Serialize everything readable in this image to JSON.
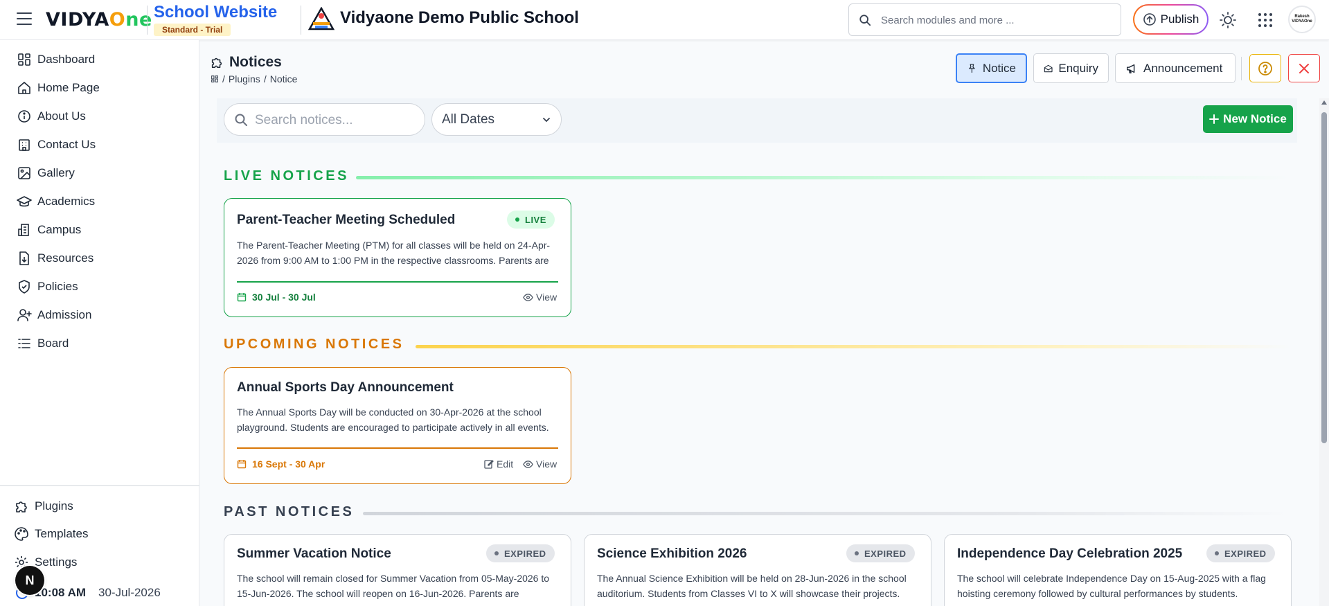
{
  "header": {
    "logo_text": "VIDYAOne",
    "site_title": "School Website",
    "plan_badge": "Standard - Trial",
    "school_name": "Vidyaone Demo Public School",
    "search_placeholder": "Search modules and more ...",
    "publish_label": "Publish",
    "avatar_line1": "Rakesh",
    "avatar_line2": "VIDYAOne"
  },
  "sidebar": {
    "items": [
      {
        "label": "Dashboard",
        "icon": "dashboard-icon"
      },
      {
        "label": "Home Page",
        "icon": "home-icon"
      },
      {
        "label": "About Us",
        "icon": "info-icon"
      },
      {
        "label": "Contact Us",
        "icon": "building-icon"
      },
      {
        "label": "Gallery",
        "icon": "image-icon"
      },
      {
        "label": "Academics",
        "icon": "graduation-cap-icon"
      },
      {
        "label": "Campus",
        "icon": "campus-icon"
      },
      {
        "label": "Resources",
        "icon": "file-download-icon"
      },
      {
        "label": "Policies",
        "icon": "shield-check-icon"
      },
      {
        "label": "Admission",
        "icon": "user-plus-icon"
      },
      {
        "label": "Board",
        "icon": "list-icon"
      }
    ],
    "bottom_items": [
      {
        "label": "Plugins",
        "icon": "puzzle-icon"
      },
      {
        "label": "Templates",
        "icon": "palette-icon"
      },
      {
        "label": "Settings",
        "icon": "gear-icon"
      }
    ],
    "fab_letter": "N",
    "time": "10:08 AM",
    "date": "30-Jul-2026"
  },
  "page": {
    "title": "Notices",
    "breadcrumb": [
      "Plugins",
      "Notice"
    ],
    "tabs": [
      {
        "label": "Notice",
        "icon": "pin-icon",
        "active": true
      },
      {
        "label": "Enquiry",
        "icon": "mail-open-icon",
        "active": false
      },
      {
        "label": "Announcement",
        "icon": "megaphone-icon",
        "active": false
      }
    ]
  },
  "filters": {
    "search_placeholder": "Search notices...",
    "date_filter": "All Dates",
    "new_notice_label": "New Notice"
  },
  "sections": {
    "live": "LIVE NOTICES",
    "upcoming": "UPCOMING NOTICES",
    "past": "PAST NOTICES"
  },
  "live_notices": [
    {
      "title": "Parent-Teacher Meeting Scheduled",
      "status": "LIVE",
      "description": "The Parent-Teacher Meeting (PTM) for all classes will be held on 24-Apr-2026 from 9:00 AM to 1:00 PM in the respective classrooms. Parents are requested to attend.",
      "date_range": "30 Jul - 30 Jul",
      "view_label": "View"
    }
  ],
  "upcoming_notices": [
    {
      "title": "Annual Sports Day Announcement",
      "description": "The Annual Sports Day will be conducted on 30-Apr-2026 at the school playground. Students are encouraged to participate actively in all events.",
      "date_range": "16 Sept - 30 Apr",
      "edit_label": "Edit",
      "view_label": "View"
    }
  ],
  "past_notices": [
    {
      "title": "Summer Vacation Notice",
      "status": "EXPIRED",
      "description": "The school will remain closed for Summer Vacation from 05-May-2026 to 15-Jun-2026. The school will reopen on 16-Jun-2026. Parents are requested to note."
    },
    {
      "title": "Science Exhibition 2026",
      "status": "EXPIRED",
      "description": "The Annual Science Exhibition will be held on 28-Jun-2026 in the school auditorium. Students from Classes VI to X will showcase their projects."
    },
    {
      "title": "Independence Day Celebration 2025",
      "status": "EXPIRED",
      "description": "The school will celebrate Independence Day on 15-Aug-2025 with a flag hoisting ceremony followed by cultural performances by students."
    }
  ],
  "colors": {
    "primary_blue": "#2563eb",
    "live_green": "#16a34a",
    "upcoming_orange": "#d97706",
    "past_gray": "#374151"
  }
}
